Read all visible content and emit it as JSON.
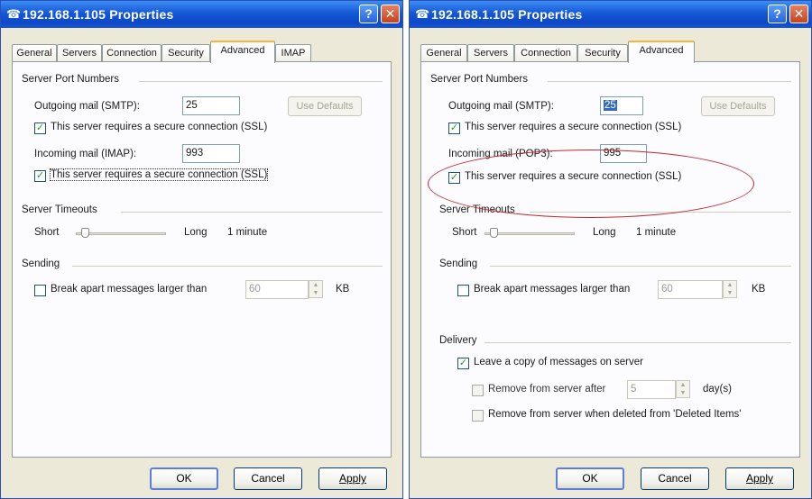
{
  "left": {
    "title": "192.168.1.105 Properties",
    "tabs": [
      "General",
      "Servers",
      "Connection",
      "Security",
      "Advanced",
      "IMAP"
    ],
    "active_tab": "Advanced",
    "server_ports_group": "Server Port Numbers",
    "outgoing_label": "Outgoing mail (SMTP):",
    "outgoing_value": "25",
    "use_defaults": "Use Defaults",
    "ssl_1_label": "This server requires a secure connection (SSL)",
    "incoming_label": "Incoming mail (IMAP):",
    "incoming_value": "993",
    "ssl_2_label": "This server requires a secure connection (SSL)",
    "timeouts_group": "Server Timeouts",
    "short_label": "Short",
    "long_label": "Long",
    "timeout_value": "1 minute",
    "sending_group": "Sending",
    "break_apart_label": "Break apart messages larger than",
    "break_apart_value": "60",
    "kb_label": "KB",
    "ok": "OK",
    "cancel": "Cancel",
    "apply": "Apply"
  },
  "right": {
    "title": "192.168.1.105 Properties",
    "tabs": [
      "General",
      "Servers",
      "Connection",
      "Security",
      "Advanced"
    ],
    "active_tab": "Advanced",
    "server_ports_group": "Server Port Numbers",
    "outgoing_label": "Outgoing mail (SMTP):",
    "outgoing_value": "25",
    "use_defaults": "Use Defaults",
    "ssl_1_label": "This server requires a secure connection (SSL)",
    "incoming_label": "Incoming mail (POP3):",
    "incoming_value": "995",
    "ssl_2_label": "This server requires a secure connection (SSL)",
    "timeouts_group": "Server Timeouts",
    "short_label": "Short",
    "long_label": "Long",
    "timeout_value": "1 minute",
    "sending_group": "Sending",
    "break_apart_label": "Break apart messages larger than",
    "break_apart_value": "60",
    "kb_label": "KB",
    "delivery_group": "Delivery",
    "leave_copy_label": "Leave a copy of messages on server",
    "remove_after_label": "Remove from server after",
    "remove_after_value": "5",
    "days_label": "day(s)",
    "remove_deleted_label": "Remove from server when deleted from 'Deleted Items'",
    "ok": "OK",
    "cancel": "Cancel",
    "apply": "Apply"
  }
}
